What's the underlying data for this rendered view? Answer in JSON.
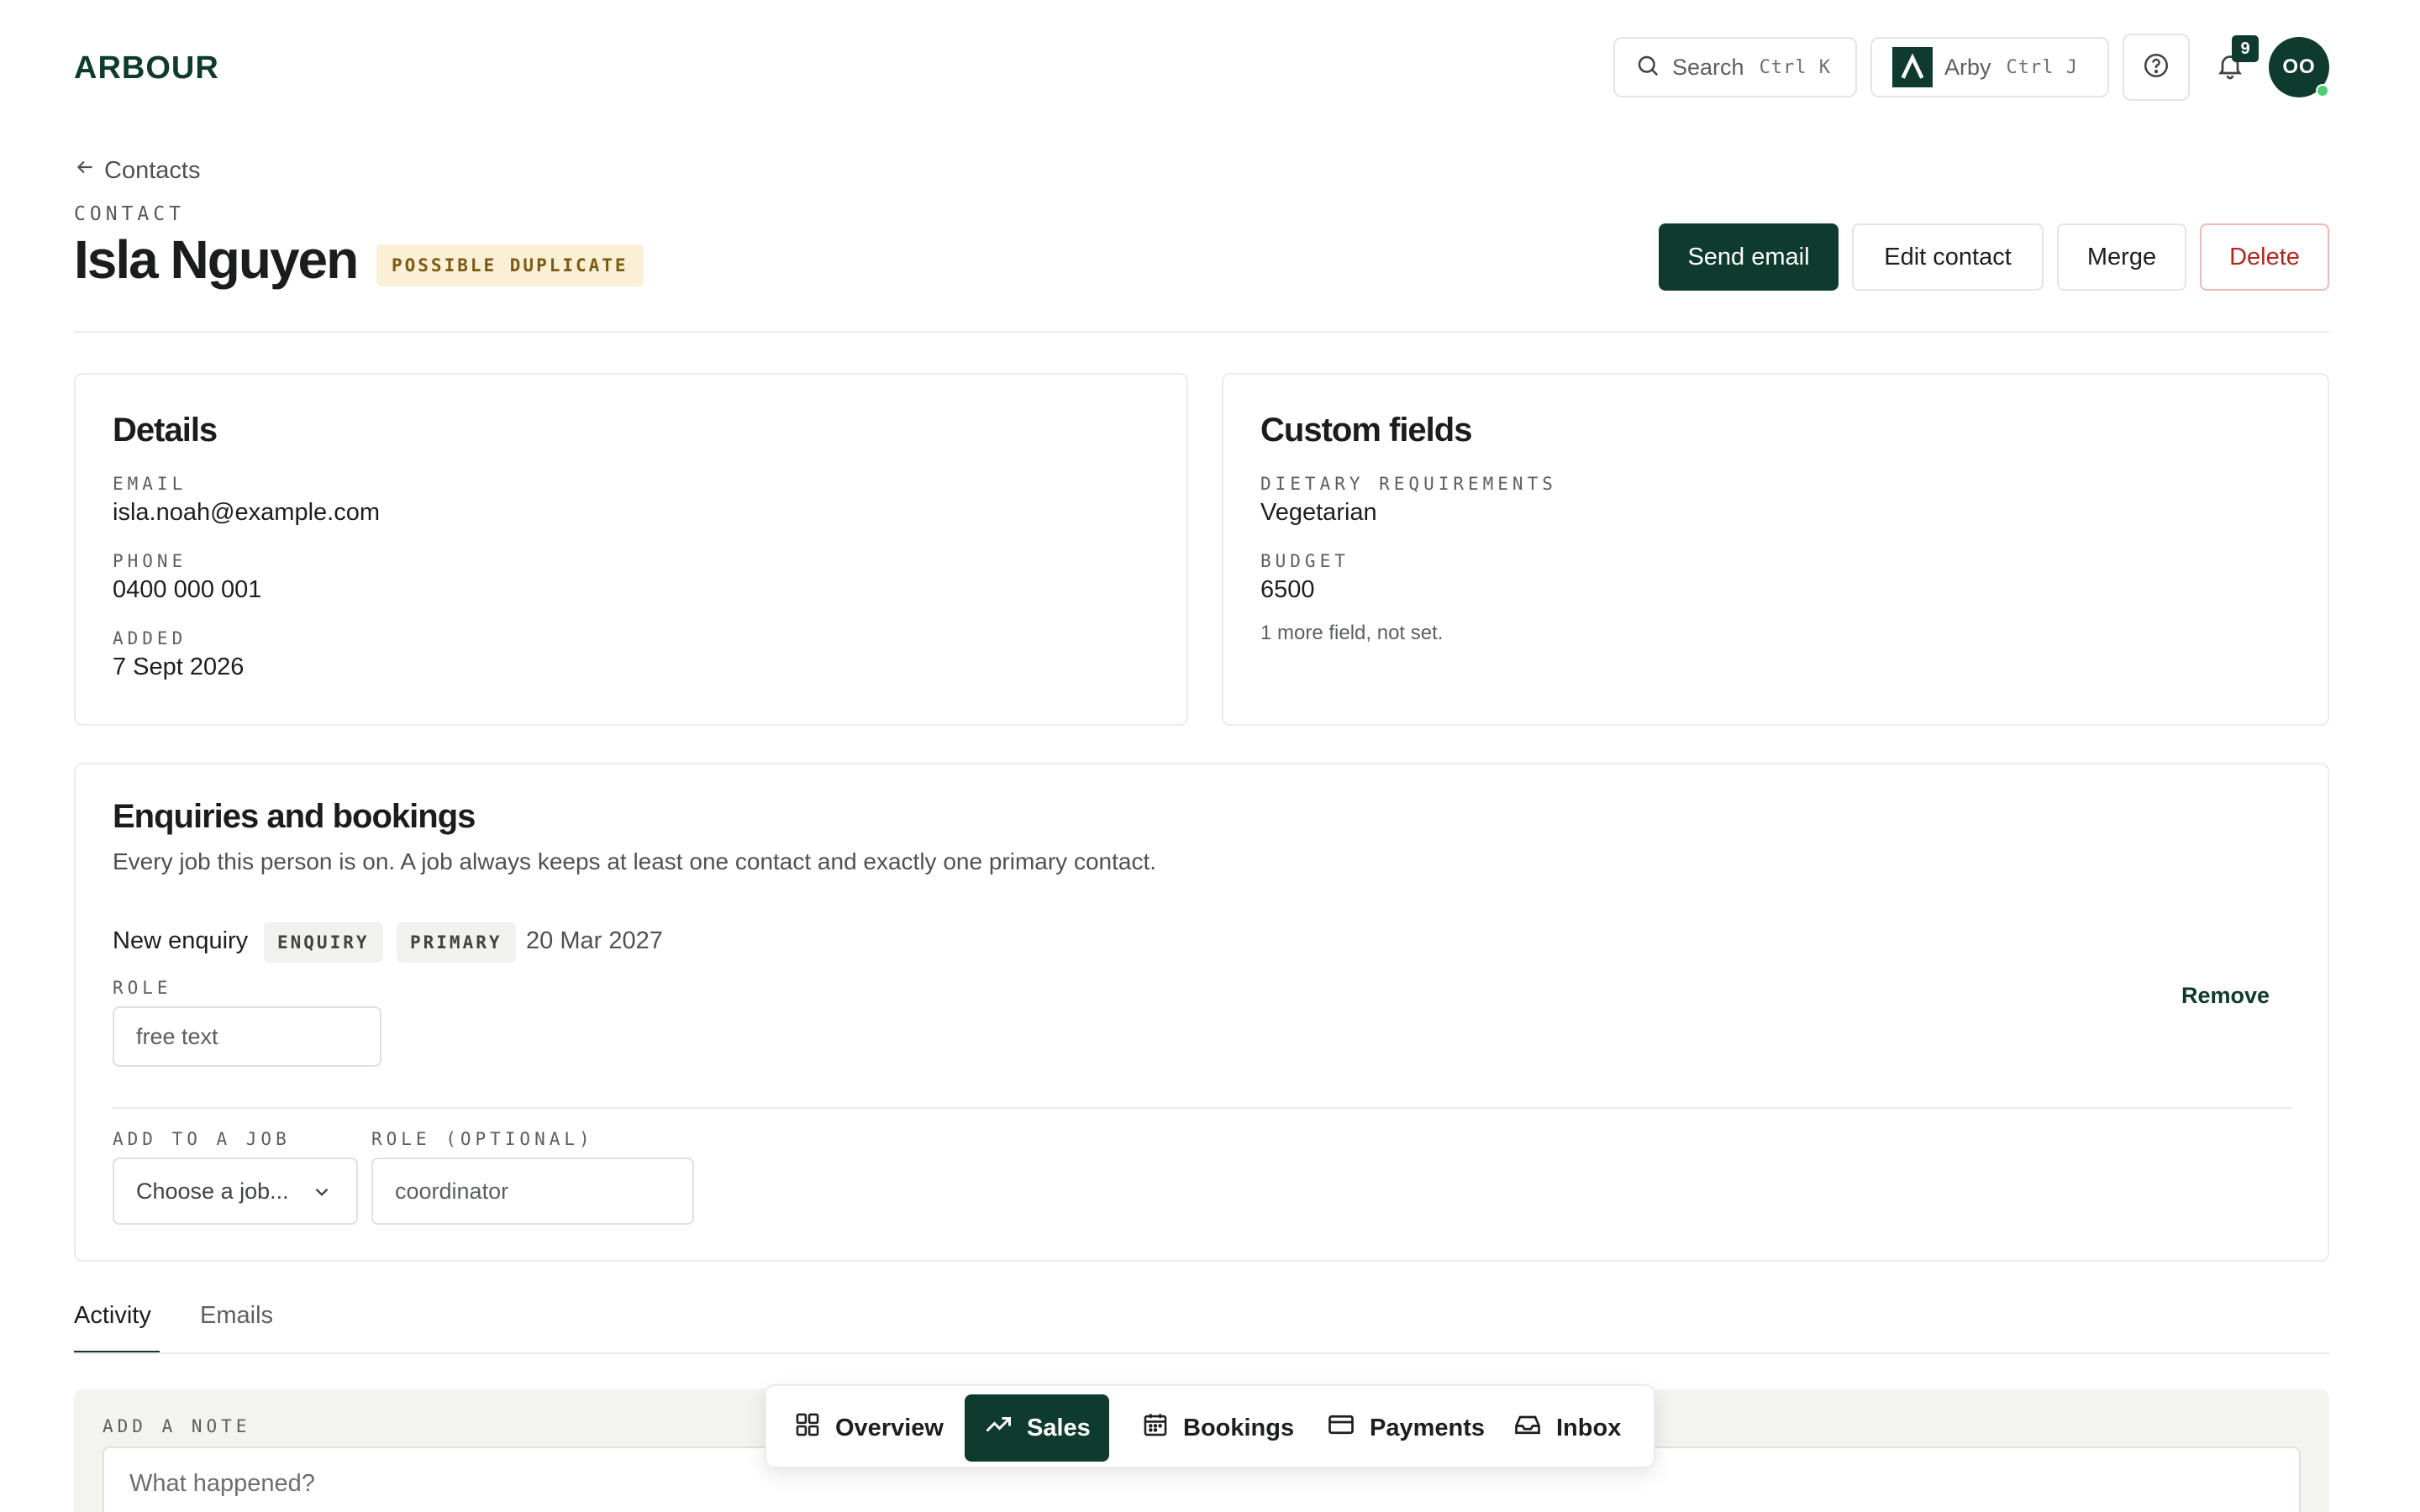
{
  "app": {
    "logo": "ARBOUR"
  },
  "topbar": {
    "search_label": "Search",
    "search_shortcut": "Ctrl K",
    "assistant_label": "Arby",
    "assistant_shortcut": "Ctrl J",
    "notification_count": "9",
    "avatar_initials": "OO"
  },
  "breadcrumb": {
    "back_label": "Contacts"
  },
  "header": {
    "eyebrow": "CONTACT",
    "name": "Isla Nguyen",
    "badge": "POSSIBLE DUPLICATE",
    "actions": {
      "send_email": "Send email",
      "edit": "Edit contact",
      "merge": "Merge",
      "delete": "Delete"
    }
  },
  "details": {
    "title": "Details",
    "fields": [
      {
        "label": "EMAIL",
        "value": "isla.noah@example.com"
      },
      {
        "label": "PHONE",
        "value": "0400 000 001"
      },
      {
        "label": "ADDED",
        "value": "7 Sept 2026"
      }
    ]
  },
  "custom_fields": {
    "title": "Custom fields",
    "fields": [
      {
        "label": "DIETARY REQUIREMENTS",
        "value": "Vegetarian"
      },
      {
        "label": "BUDGET",
        "value": "6500"
      }
    ],
    "more_note": "1 more field, not set."
  },
  "enquiries": {
    "title": "Enquiries and bookings",
    "description": "Every job this person is on. A job always keeps at least one contact and exactly one primary contact.",
    "job": {
      "name": "New enquiry",
      "type_tag": "ENQUIRY",
      "primary_tag": "PRIMARY",
      "date": "20 Mar 2027",
      "role_label": "ROLE",
      "role_placeholder": "free text",
      "remove_label": "Remove"
    },
    "add": {
      "job_label": "ADD TO A JOB",
      "job_select": "Choose a job...",
      "role_label": "ROLE (OPTIONAL)",
      "role_placeholder": "coordinator"
    }
  },
  "tabs": [
    {
      "label": "Activity",
      "active": true
    },
    {
      "label": "Emails",
      "active": false
    }
  ],
  "note": {
    "label": "ADD A NOTE",
    "placeholder": "What happened?"
  },
  "bottom_nav": [
    {
      "label": "Overview",
      "icon": "grid-icon",
      "active": false
    },
    {
      "label": "Sales",
      "icon": "trending-up-icon",
      "active": true
    },
    {
      "label": "Bookings",
      "icon": "calendar-icon",
      "active": false
    },
    {
      "label": "Payments",
      "icon": "credit-card-icon",
      "active": false
    },
    {
      "label": "Inbox",
      "icon": "inbox-icon",
      "active": false
    }
  ],
  "colors": {
    "brand": "#0e3b2e",
    "danger": "#b3261e",
    "warning_bg": "#fbf0d6",
    "online": "#4ccf6a"
  }
}
